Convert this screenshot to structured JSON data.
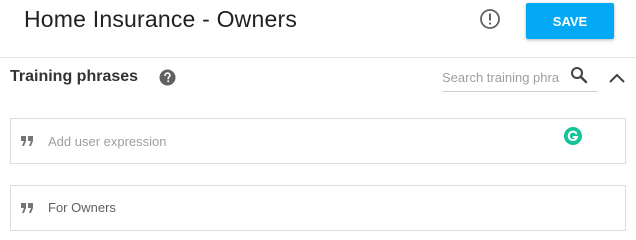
{
  "header": {
    "title": "Home Insurance - Owners",
    "info_icon": "exclamation-circle-icon",
    "save_label": "SAVE"
  },
  "colors": {
    "save_button": "#03a9f4",
    "grammarly": "#15c39a",
    "border": "#dcdcdc"
  },
  "training_phrases": {
    "title": "Training phrases",
    "help_icon": "question-circle-icon",
    "search": {
      "placeholder": "Search training phra",
      "value": ""
    },
    "collapse_icon": "chevron-up-icon",
    "add_expression": {
      "placeholder": "Add user expression",
      "value": ""
    },
    "phrases": [
      {
        "text": "For Owners",
        "icon": "quote-icon"
      }
    ]
  }
}
